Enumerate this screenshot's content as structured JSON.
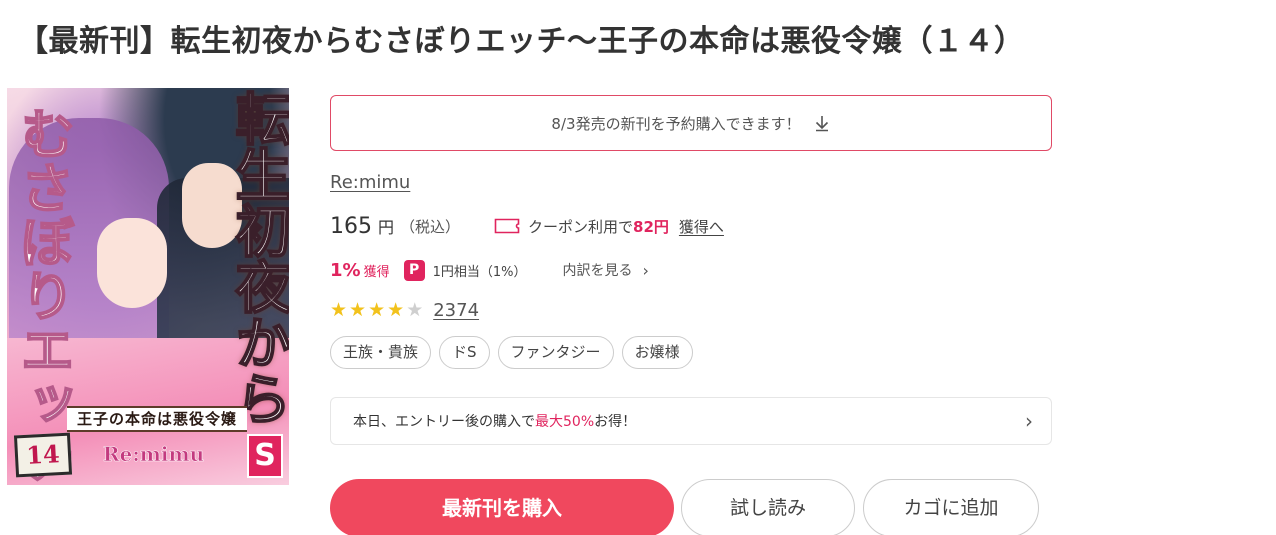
{
  "title": "【最新刊】転生初夜からむさぼりエッチ～王子の本命は悪役令嬢（１４）",
  "cover": {
    "title_vertical": "転生初夜から",
    "title_vertical2": "むさぼりエッチ",
    "subtitle": "王子の本命は悪役令嬢",
    "volume": "14",
    "author": "Re:mimu",
    "logo": "S"
  },
  "preorder": {
    "label": "8/3発売の新刊を予約購入できます！",
    "icon": "arrow-down-icon"
  },
  "author": "Re:mimu",
  "price": {
    "amount": "165",
    "unit": "円",
    "tax": "（税込）",
    "coupon_text": "クーポン利用で",
    "coupon_amount": "82円",
    "coupon_link": "獲得へ"
  },
  "points": {
    "percent": "1%",
    "percent_label": "獲得",
    "icon_letter": "P",
    "equivalent": "1円相当（1%）",
    "breakdown": "内訳を見る"
  },
  "rating": {
    "stars": 4,
    "max": 5,
    "count": "2374"
  },
  "tags": [
    "王族・貴族",
    "ドS",
    "ファンタジー",
    "お嬢様"
  ],
  "campaign": {
    "before": "本日、エントリー後の購入で",
    "highlight": "最大50%",
    "after": "お得！"
  },
  "buttons": {
    "buy": "最新刊を購入",
    "trial": "試し読み",
    "cart": "カゴに追加"
  },
  "colors": {
    "accent": "#e0245e",
    "buy_button": "#f0485e",
    "star": "#f2c21c"
  }
}
